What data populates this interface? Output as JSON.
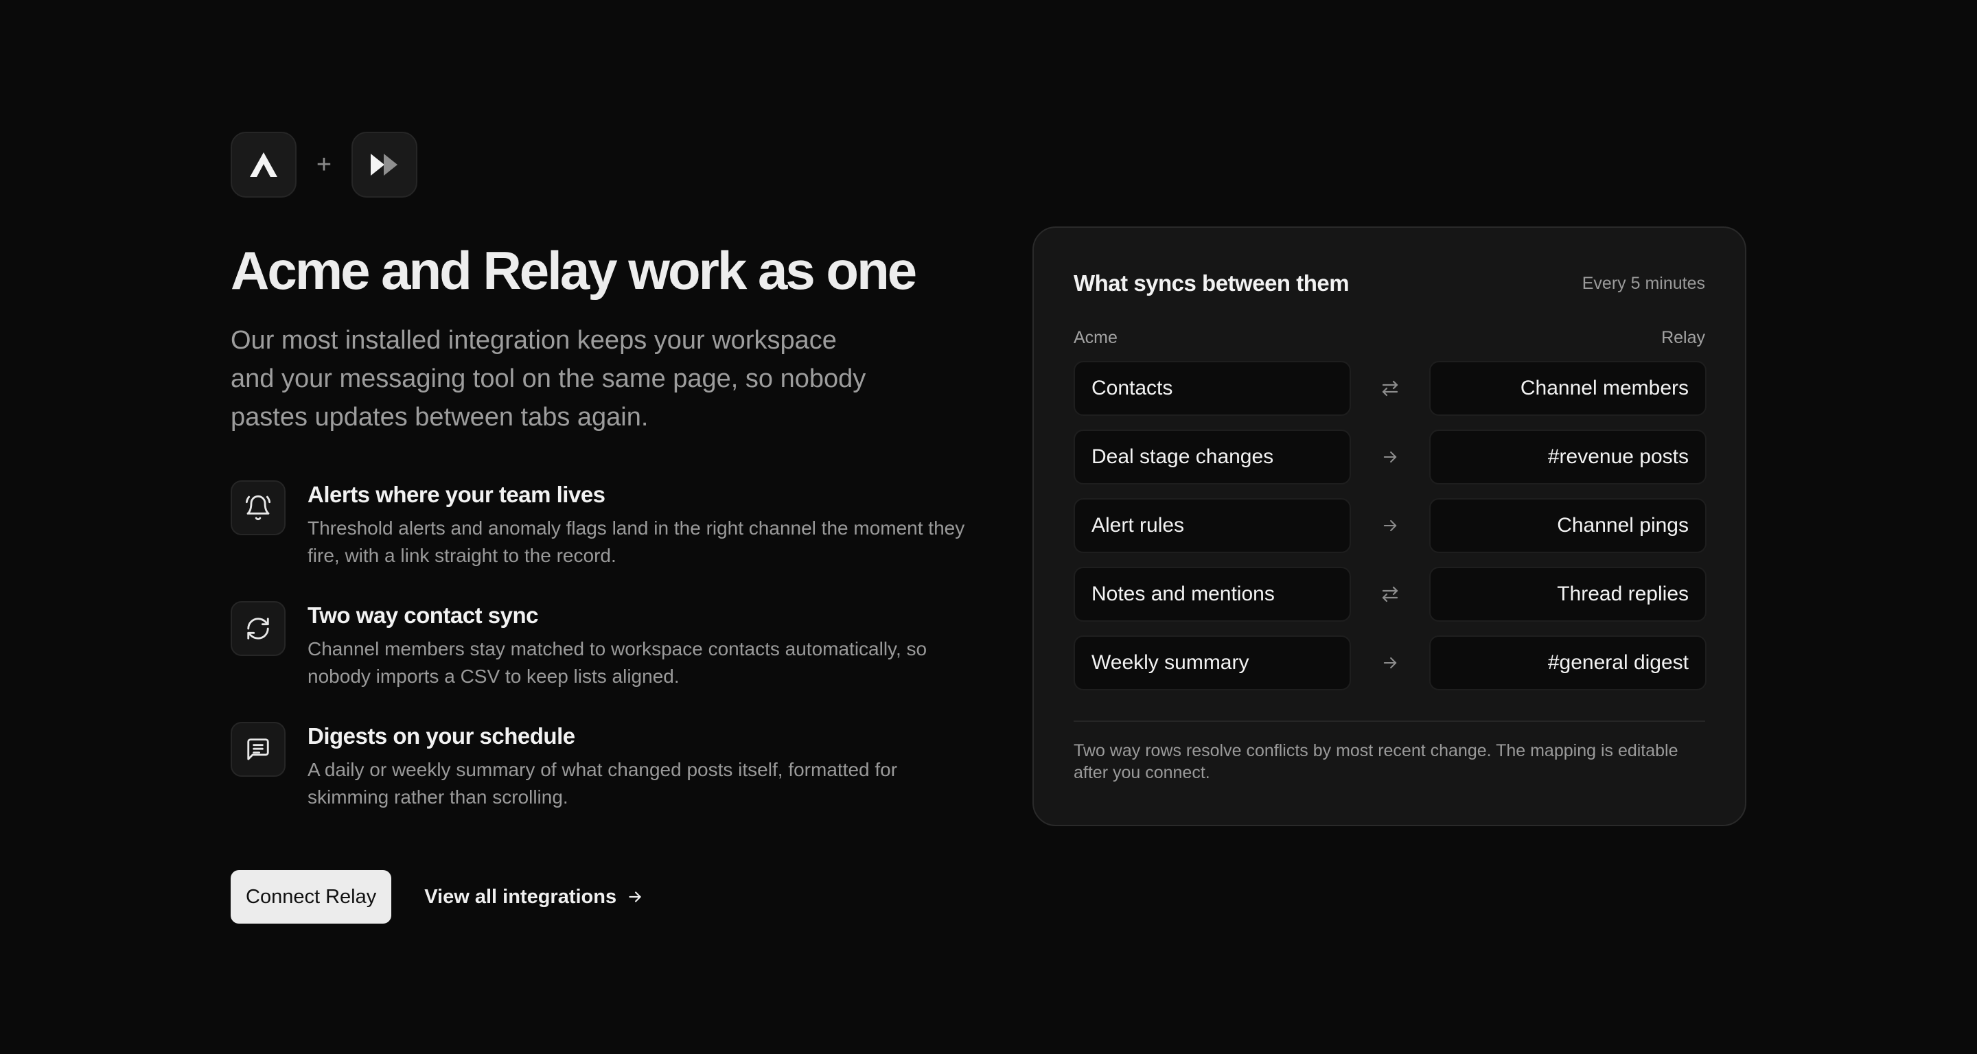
{
  "brands": {
    "left_logo": "acme-logo",
    "plus": "+",
    "right_logo": "relay-logo"
  },
  "hero": {
    "title": "Acme and Relay work as one",
    "lede": "Our most installed integration keeps your workspace and your messaging tool on the same page, so nobody pastes updates between tabs again."
  },
  "features": [
    {
      "icon": "bell-icon",
      "title": "Alerts where your team lives",
      "description": "Threshold alerts and anomaly flags land in the right channel the moment they fire, with a link straight to the record."
    },
    {
      "icon": "refresh-icon",
      "title": "Two way contact sync",
      "description": "Channel members stay matched to workspace contacts automatically, so nobody imports a CSV to keep lists aligned."
    },
    {
      "icon": "message-icon",
      "title": "Digests on your schedule",
      "description": "A daily or weekly summary of what changed posts itself, formatted for skimming rather than scrolling."
    }
  ],
  "actions": {
    "primary_label": "Connect Relay",
    "secondary_label": "View all integrations"
  },
  "sync_card": {
    "title": "What syncs between them",
    "frequency": "Every 5 minutes",
    "left_column": "Acme",
    "right_column": "Relay",
    "rows": [
      {
        "source": "Contacts",
        "direction": "two-way",
        "target": "Channel members"
      },
      {
        "source": "Deal stage changes",
        "direction": "one-way",
        "target": "#revenue posts"
      },
      {
        "source": "Alert rules",
        "direction": "one-way",
        "target": "Channel pings"
      },
      {
        "source": "Notes and mentions",
        "direction": "two-way",
        "target": "Thread replies"
      },
      {
        "source": "Weekly summary",
        "direction": "one-way",
        "target": "#general digest"
      }
    ],
    "footnote": "Two way rows resolve conflicts by most recent change. The mapping is editable after you connect."
  },
  "colors": {
    "background": "#0a0a0a",
    "card": "#161616",
    "primary_button": "#ececec",
    "muted_text": "#9a9a9a"
  }
}
